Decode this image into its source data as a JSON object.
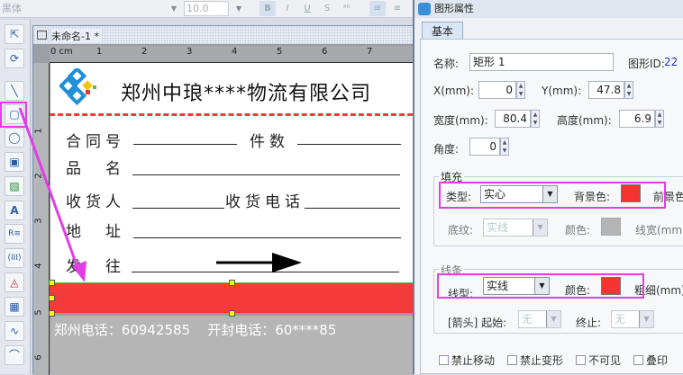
{
  "toolbar_top": {
    "font": "黑体",
    "size": "10.0",
    "bold": "B",
    "italic": "I",
    "underline": "U",
    "strike": "S",
    "sub": "ᵃᵇ"
  },
  "tools": [
    "pointer-tool",
    "rotate-tool",
    "line-tool",
    "rectangle-tool",
    "ellipse-tool",
    "image-tool",
    "picture-tool",
    "text-tool",
    "richtext-tool",
    "barcode-tool",
    "shape-tool",
    "qrcode-tool",
    "curve-tool",
    "arc-tool"
  ],
  "document": {
    "title": "未命名-1 *",
    "ruler_top": [
      "0 cm",
      "1",
      "2",
      "3",
      "4",
      "5",
      "6",
      "7"
    ],
    "ruler_left": [
      "1",
      "2",
      "3",
      "4",
      "5",
      "6"
    ]
  },
  "label": {
    "company": "郑州中琅****物流有限公司",
    "contract": "合同号",
    "pieces": "件数",
    "product": "品　名",
    "receiver": "收货人",
    "receiver_phone": "收货电话",
    "address": "地　址",
    "destination": "发　往",
    "band_text": "郑州电话：60942585    开封电话：60****85",
    "accent_color": "#f53a3a"
  },
  "dialog": {
    "title": "图形属性",
    "tab": "基本",
    "name_label": "名称:",
    "name_value": "矩形 1",
    "id_label": "图形ID:",
    "id_value": "22",
    "x_label": "X(mm):",
    "x_value": "0",
    "y_label": "Y(mm):",
    "y_value": "47.8",
    "w_label": "宽度(mm):",
    "w_value": "80.4",
    "h_label": "高度(mm):",
    "h_value": "6.9",
    "angle_label": "角度:",
    "angle_value": "0",
    "fill": {
      "group": "填充",
      "type_label": "类型:",
      "type_value": "实心",
      "bg_label": "背景色:",
      "bg_color": "#f53333",
      "fg_label": "前景色",
      "pattern_label": "底纹:",
      "pattern_value": "实线",
      "color_label": "颜色:",
      "pattern_color": "#b4b4b4",
      "linewidth_label": "线宽(mm):"
    },
    "line": {
      "group": "线条",
      "type_label": "线型:",
      "type_value": "实线",
      "color_label": "颜色:",
      "color": "#f53333",
      "thick_label": "粗细(mm):",
      "arrow_label": "[箭头] 起始:",
      "arrow_start": "无",
      "end_label": "终止:",
      "arrow_end": "无"
    },
    "checks": [
      "禁止移动",
      "禁止变形",
      "不可见",
      "叠印"
    ]
  }
}
